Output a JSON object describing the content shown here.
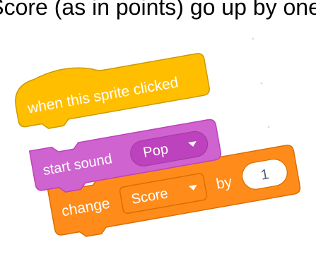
{
  "caption": "Score (as in points) go up by one.",
  "blocks": {
    "hat": {
      "label": "when this sprite clicked",
      "color": "#FFBF00",
      "border": "#CC9900"
    },
    "sound": {
      "label": "start sound",
      "dropdown_value": "Pop",
      "color": "#CF63CF",
      "border": "#BD42BD"
    },
    "change": {
      "label": "change",
      "variable": "Score",
      "by_label": "by",
      "amount": "1",
      "color": "#FF8C1A",
      "border": "#DB6E00"
    }
  },
  "icons": {
    "dropdown": "caret-down-icon"
  }
}
